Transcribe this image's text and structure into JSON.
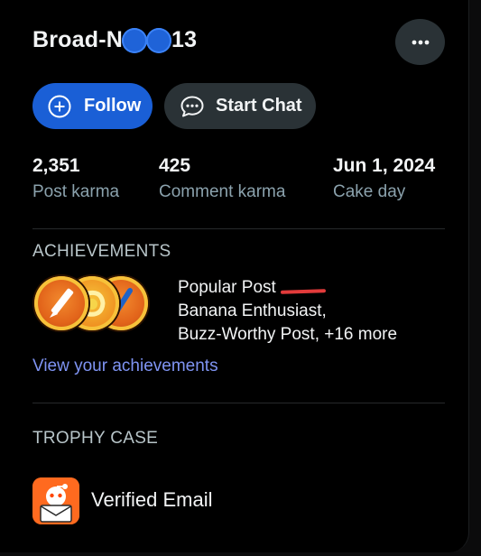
{
  "profile": {
    "name_prefix": "Broad-N",
    "name_suffix": "13"
  },
  "actions": {
    "follow_label": "Follow",
    "chat_label": "Start Chat"
  },
  "stats": [
    {
      "value": "2,351",
      "label": "Post karma"
    },
    {
      "value": "425",
      "label": "Comment karma"
    },
    {
      "value": "Jun 1, 2024",
      "label": "Cake day"
    }
  ],
  "achievements": {
    "heading": "ACHIEVEMENTS",
    "lines": [
      "Popular Post",
      "Banana Enthusiast,",
      "Buzz-Worthy Post, +16 more"
    ],
    "link": "View your achievements"
  },
  "trophies": {
    "heading": "TROPHY CASE",
    "items": [
      {
        "label": "Verified Email",
        "icon": "verified-email-icon"
      }
    ]
  },
  "colors": {
    "accent": "#1a5fd6",
    "link": "#7f94f3",
    "muted": "#8ba2ad",
    "button_bg": "#2a3236",
    "redaction_mark": "#e23b3b"
  }
}
